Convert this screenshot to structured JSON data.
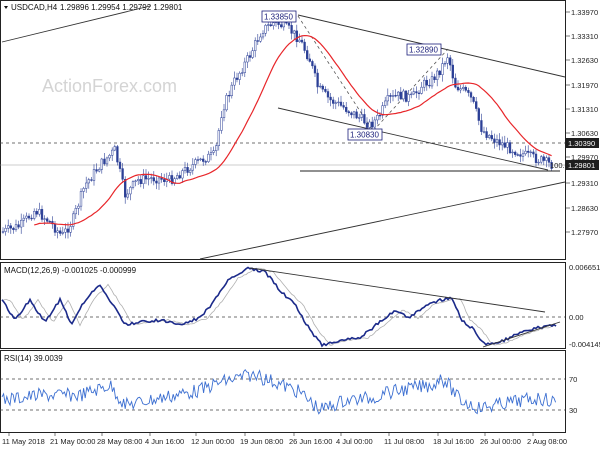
{
  "header": {
    "symbol": "USDCAD,H4",
    "ohlc": "1.29896 1.29954 1.29792 1.29801",
    "watermark": "ActionForex.com"
  },
  "price_axis": {
    "labels": [
      "1.33970",
      "1.33310",
      "1.32630",
      "1.31970",
      "1.31310",
      "1.30630",
      "1.29970",
      "1.29310",
      "1.28630",
      "1.27970"
    ],
    "marker_label": "100.00",
    "current_price": "1.29801",
    "level_price": "1.30390"
  },
  "annotations": [
    {
      "id": "high",
      "text": "1.33850"
    },
    {
      "id": "high2",
      "text": "1.32890"
    },
    {
      "id": "low",
      "text": "1.30830"
    }
  ],
  "macd": {
    "title": "MACD(12,26,9) -0.001025 -0.000999",
    "axis_labels": [
      "0.006651",
      "0.00",
      "-0.004145"
    ]
  },
  "rsi": {
    "title": "RSI(14) 39.0039",
    "axis_labels": [
      "70",
      "30"
    ]
  },
  "time_axis": {
    "labels": [
      "11 May 2018",
      "21 May 00:00",
      "28 May 08:00",
      "4 Jun 16:00",
      "12 Jun 00:00",
      "19 Jun 08:00",
      "26 Jun 16:00",
      "4 Jul 00:00",
      "11 Jul 08:00",
      "18 Jul 16:00",
      "26 Jul 00:00",
      "2 Aug 08:00"
    ]
  },
  "colors": {
    "bull_candle": "#2b3f96",
    "bear_candle": "#2b3f96",
    "ma": "#e8262a",
    "macd_line": "#1b2a8a",
    "signal_line": "#b0b0b0",
    "trendline": "#333333",
    "current_badge": "#1e1e1e"
  }
}
